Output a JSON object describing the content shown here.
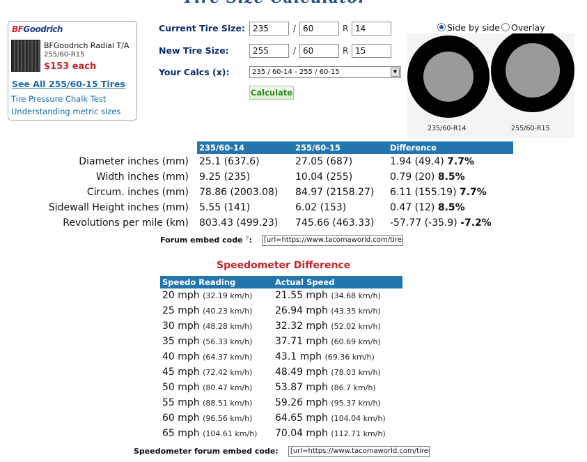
{
  "header": {
    "title": "Tire Size Calculator"
  },
  "ad": {
    "brand_a": "BF",
    "brand_b": "Goodrich",
    "product_name": "BFGoodrich Radial T/A",
    "product_size": "255/60-R15",
    "price": "$153 each",
    "see_all": "See All 255/60-15 Tires",
    "link_pressure": "Tire Pressure Chalk Test",
    "link_metric": "Understanding metric sizes"
  },
  "form": {
    "current_label": "Current Tire Size:",
    "new_label": "New Tire Size:",
    "calcs_label": "Your Calcs (x):",
    "current": {
      "width": "235",
      "aspect": "60",
      "rim": "14"
    },
    "new": {
      "width": "255",
      "aspect": "60",
      "rim": "15"
    },
    "slash": "/",
    "r": "R",
    "calcs_selected": "235 / 60-14 - 255 / 60-15",
    "calculate": "Calculate"
  },
  "view": {
    "side_by_side": "Side by side",
    "overlay": "Overlay",
    "left_label": "235/60-R14",
    "right_label": "255/60-R15"
  },
  "results": {
    "headers": [
      "235/60-14",
      "255/60-15",
      "Difference"
    ],
    "rows": [
      {
        "label": "Diameter inches (mm)",
        "a": "25.1 (637.6)",
        "b": "27.05 (687)",
        "diff": "1.94 (49.4)",
        "pct": "7.7%"
      },
      {
        "label": "Width inches (mm)",
        "a": "9.25 (235)",
        "b": "10.04 (255)",
        "diff": "0.79 (20)",
        "pct": "8.5%"
      },
      {
        "label": "Circum. inches (mm)",
        "a": "78.86 (2003.08)",
        "b": "84.97 (2158.27)",
        "diff": "6.11 (155.19)",
        "pct": "7.7%"
      },
      {
        "label": "Sidewall Height inches (mm)",
        "a": "5.55 (141)",
        "b": "6.02 (153)",
        "diff": "0.47 (12)",
        "pct": "8.5%"
      },
      {
        "label": "Revolutions per mile (km)",
        "a": "803.43 (499.23)",
        "b": "745.66 (463.33)",
        "diff": "-57.77 (-35.9)",
        "pct": "-7.2%"
      }
    ],
    "embed_label": "Forum embed code",
    "help": "?",
    "embed_colon": ":",
    "embed_value": "[url=https://www.tacomaworld.com/tirecs"
  },
  "speedo": {
    "title": "Speedometer Difference",
    "headers": [
      "Speedo Reading",
      "Actual Speed"
    ],
    "rows": [
      {
        "reading": "20 mph",
        "reading_km": "(32.19 km/h)",
        "actual": "21.55 mph",
        "actual_km": "(34.68 km/h)"
      },
      {
        "reading": "25 mph",
        "reading_km": "(40.23 km/h)",
        "actual": "26.94 mph",
        "actual_km": "(43.35 km/h)"
      },
      {
        "reading": "30 mph",
        "reading_km": "(48.28 km/h)",
        "actual": "32.32 mph",
        "actual_km": "(52.02 km/h)"
      },
      {
        "reading": "35 mph",
        "reading_km": "(56.33 km/h)",
        "actual": "37.71 mph",
        "actual_km": "(60.69 km/h)"
      },
      {
        "reading": "40 mph",
        "reading_km": "(64.37 km/h)",
        "actual": "43.1 mph",
        "actual_km": "(69.36 km/h)"
      },
      {
        "reading": "45 mph",
        "reading_km": "(72.42 km/h)",
        "actual": "48.49 mph",
        "actual_km": "(78.03 km/h)"
      },
      {
        "reading": "50 mph",
        "reading_km": "(80.47 km/h)",
        "actual": "53.87 mph",
        "actual_km": "(86.7 km/h)"
      },
      {
        "reading": "55 mph",
        "reading_km": "(88.51 km/h)",
        "actual": "59.26 mph",
        "actual_km": "(95.37 km/h)"
      },
      {
        "reading": "60 mph",
        "reading_km": "(96.56 km/h)",
        "actual": "64.65 mph",
        "actual_km": "(104.04 km/h)"
      },
      {
        "reading": "65 mph",
        "reading_km": "(104.61 km/h)",
        "actual": "70.04 mph",
        "actual_km": "(112.71 km/h)"
      }
    ],
    "embed_label": "Speedometer forum embed code:",
    "embed_value": "[url=https://www.tacomaworld.com/tirecs"
  },
  "colors": {
    "header_blue": "#2376ad",
    "label_navy": "#0b2b6b",
    "accent_red": "#c4242b",
    "link_blue": "#1a6aa8"
  }
}
